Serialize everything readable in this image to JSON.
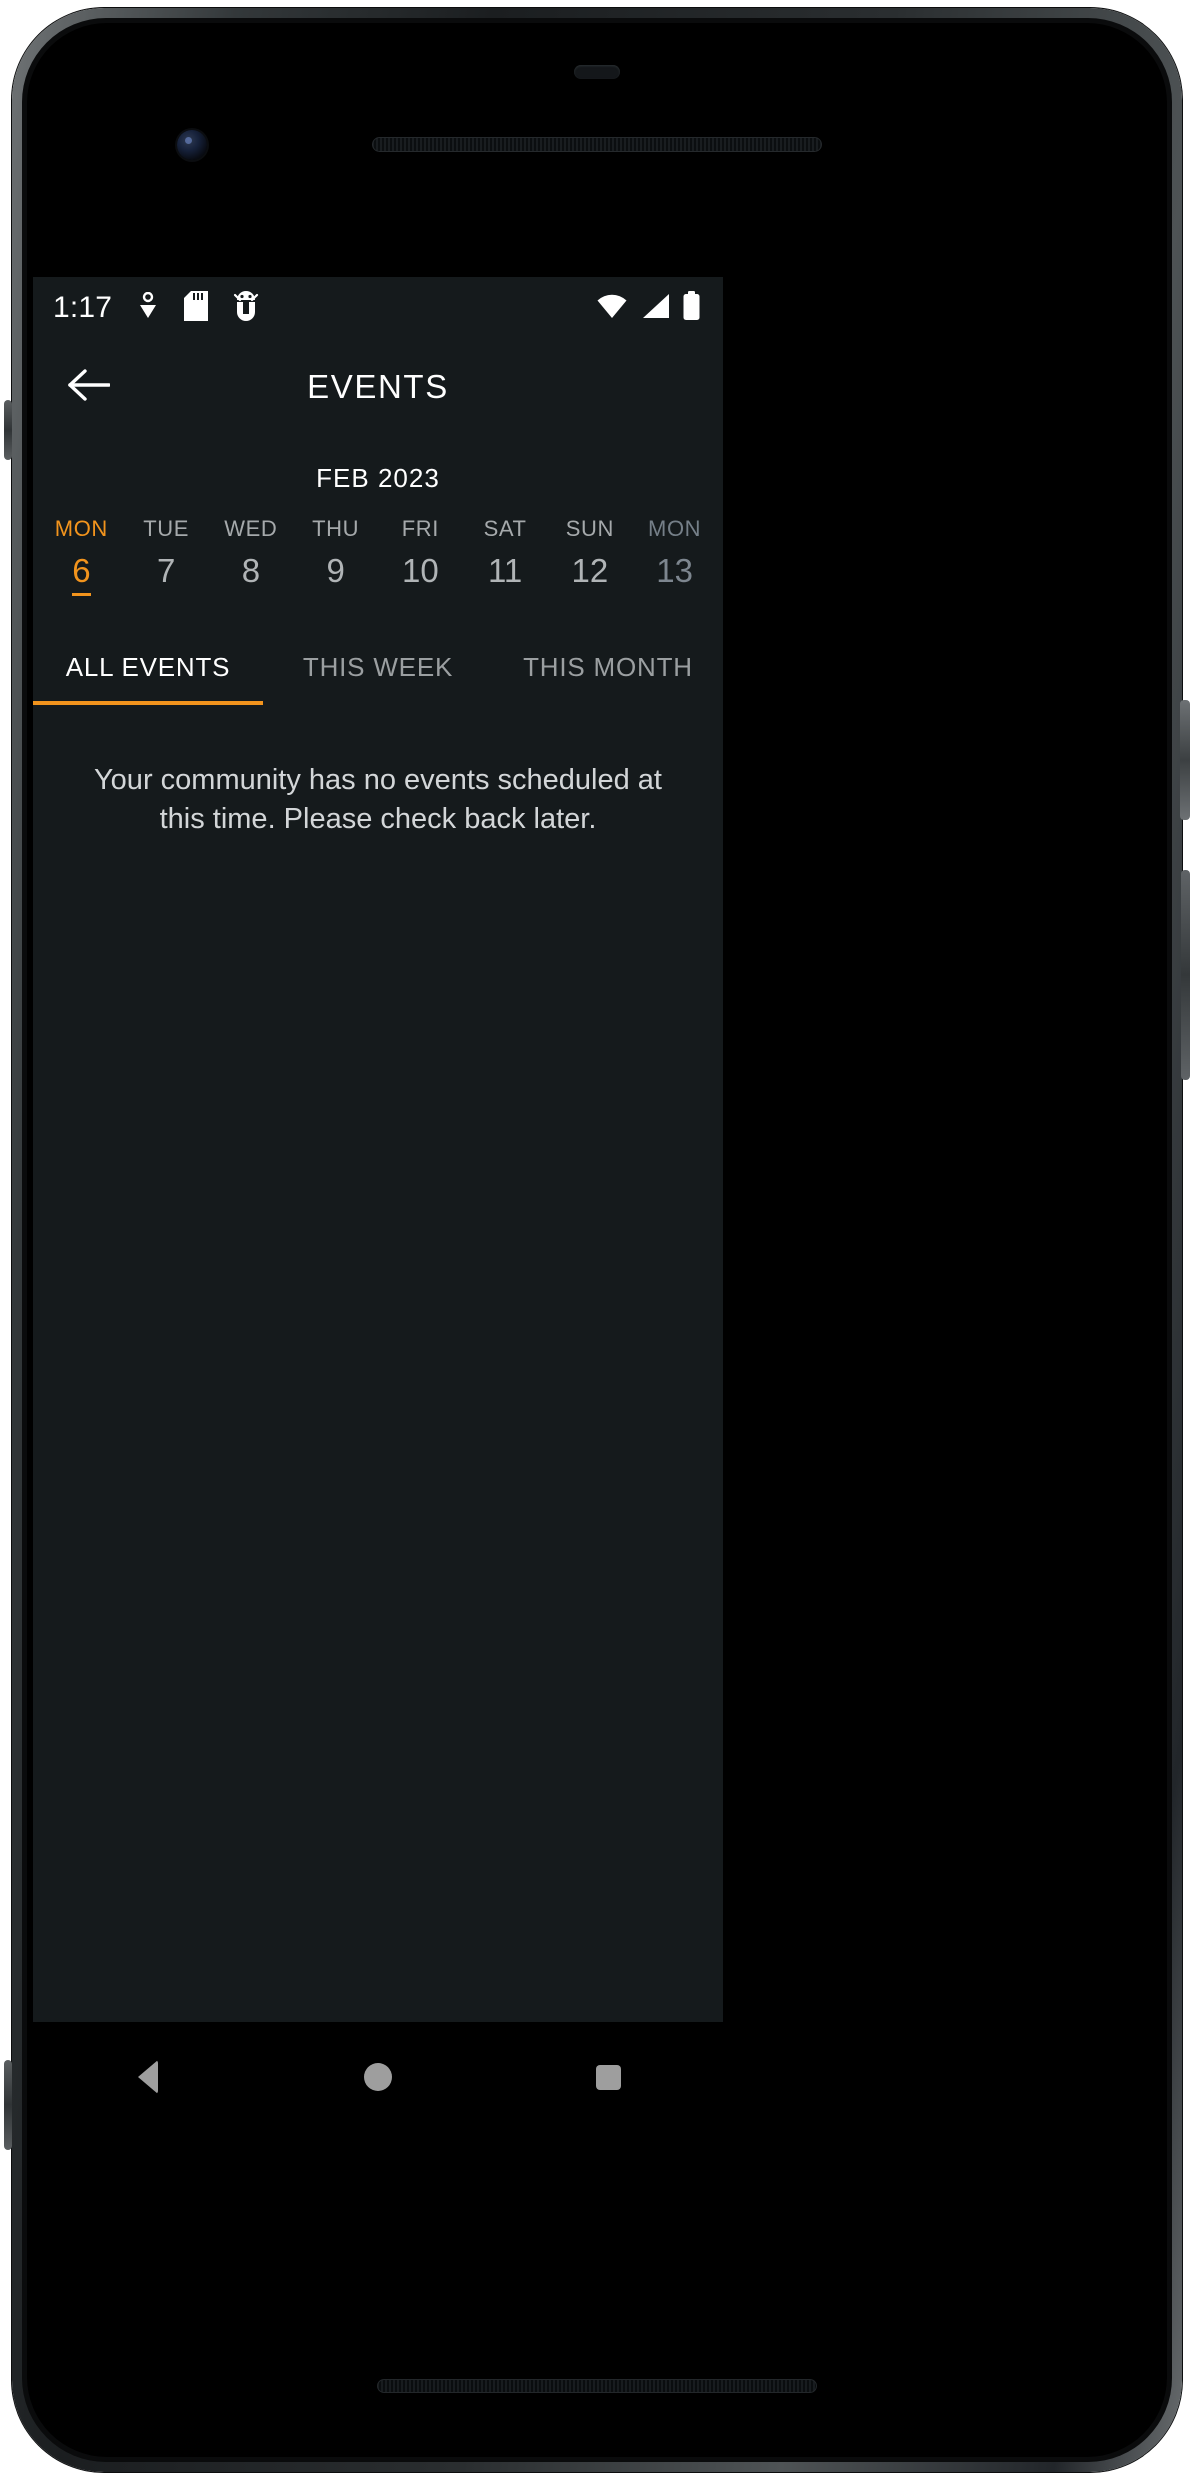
{
  "status_bar": {
    "time": "1:17",
    "left_icons": [
      "downloads-icon",
      "sd-card-icon",
      "android-debug-icon"
    ],
    "right_icons": [
      "wifi-icon",
      "cellular-signal-icon",
      "battery-full-icon"
    ]
  },
  "app_bar": {
    "back_icon": "arrow-left-icon",
    "title": "EVENTS"
  },
  "calendar": {
    "month_label": "FEB 2023",
    "days": [
      {
        "name": "MON",
        "num": "6",
        "state": "selected"
      },
      {
        "name": "TUE",
        "num": "7",
        "state": "normal"
      },
      {
        "name": "WED",
        "num": "8",
        "state": "normal"
      },
      {
        "name": "THU",
        "num": "9",
        "state": "normal"
      },
      {
        "name": "FRI",
        "num": "10",
        "state": "normal"
      },
      {
        "name": "SAT",
        "num": "11",
        "state": "normal"
      },
      {
        "name": "SUN",
        "num": "12",
        "state": "normal"
      },
      {
        "name": "MON",
        "num": "13",
        "state": "dim"
      }
    ]
  },
  "tabs": [
    {
      "label": "ALL EVENTS",
      "active": true
    },
    {
      "label": "THIS WEEK",
      "active": false
    },
    {
      "label": "THIS MONTH",
      "active": false
    }
  ],
  "content": {
    "empty_message": "Your community has no events scheduled at this time. Please check back later."
  },
  "nav_bar": {
    "back": "nav-back-icon",
    "home": "nav-home-icon",
    "recents": "nav-recents-icon"
  },
  "colors": {
    "accent": "#f2941d",
    "screen_bg": "#151a1c",
    "nav_bg": "#000000",
    "text_primary": "#ffffff",
    "text_secondary": "#b0b4b6",
    "text_dim": "#7d868f"
  }
}
